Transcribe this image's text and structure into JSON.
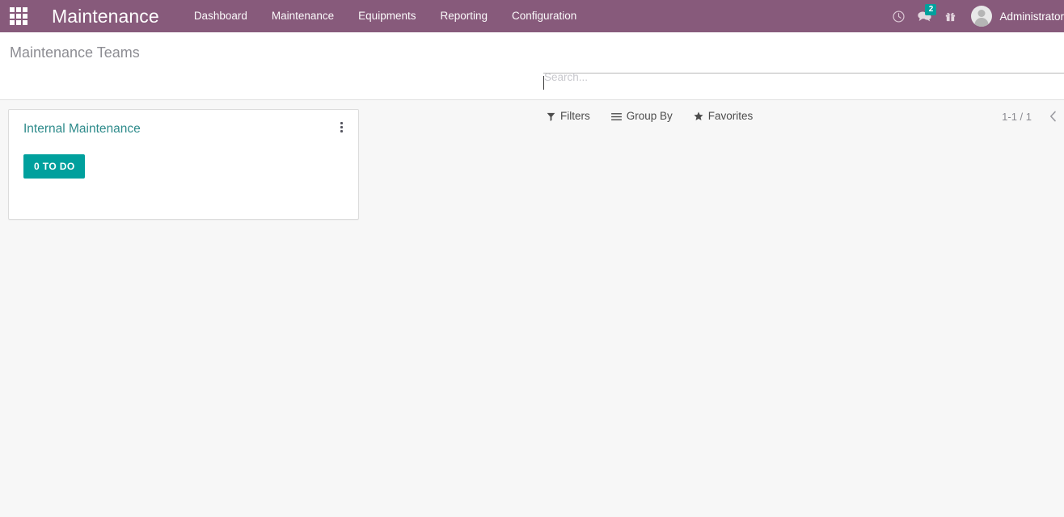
{
  "navbar": {
    "apps_icon": "apps-grid-icon",
    "brand": "Maintenance",
    "menu_items": [
      {
        "label": "Dashboard"
      },
      {
        "label": "Maintenance"
      },
      {
        "label": "Equipments"
      },
      {
        "label": "Reporting"
      },
      {
        "label": "Configuration"
      }
    ],
    "systray": {
      "clock_icon": "clock-icon",
      "messages_icon": "chat-bubble-icon",
      "messages_count": "2",
      "gift_icon": "gift-icon",
      "avatar_icon": "user-avatar-icon",
      "username": "Administrator"
    }
  },
  "control_panel": {
    "breadcrumb": "Maintenance Teams",
    "search": {
      "placeholder": "Search...",
      "value": ""
    },
    "buttons": [
      {
        "label": "Filters",
        "icon": "filter-funnel-icon"
      },
      {
        "label": "Group By",
        "icon": "group-by-lines-icon"
      },
      {
        "label": "Favorites",
        "icon": "star-icon"
      }
    ],
    "pager": {
      "range": "1-1 / 1",
      "previous_icon": "chevron-left-icon"
    }
  },
  "kanban": {
    "cards": [
      {
        "title": "Internal Maintenance",
        "todo_label": "0 TO DO",
        "menu_icon": "vertical-ellipsis-icon"
      }
    ]
  },
  "colors": {
    "navbar": "#875a7b",
    "accent_teal": "#00a09d",
    "card_title": "#2e8b8b",
    "page_background": "#f7f7f7"
  }
}
